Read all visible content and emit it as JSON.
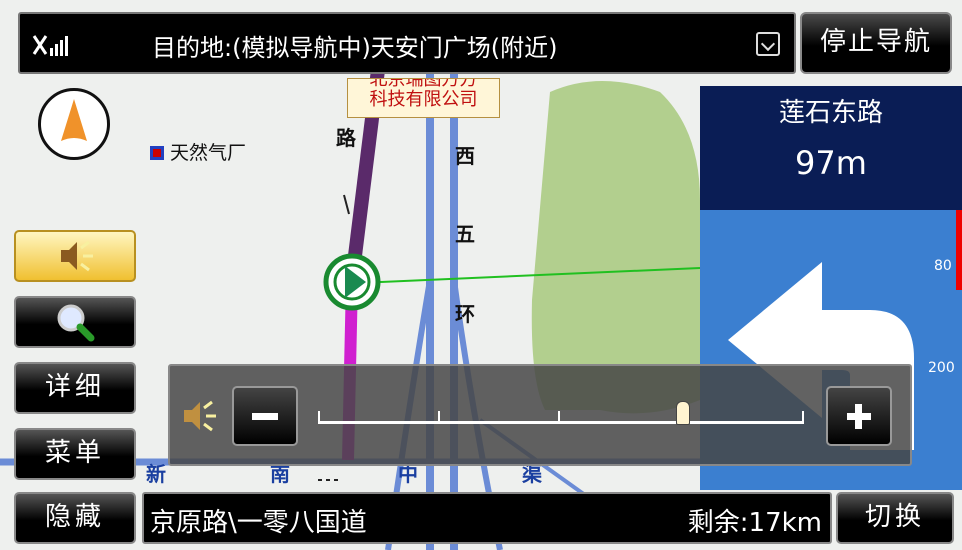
{
  "header": {
    "destination": "目的地:(模拟导航中)天安门广场(附近)",
    "stop_label": "停止导航"
  },
  "map": {
    "poi_label": "天然气厂",
    "company_lines": [
      "北京瑞图万方",
      "科技有限公司"
    ],
    "road_chars": [
      "路",
      "西",
      "五",
      "环"
    ],
    "bottom_chars": [
      "新",
      "南",
      "中",
      "渠"
    ]
  },
  "guide": {
    "next_road": "莲石东路",
    "distance": "97m",
    "scale_top": "80",
    "scale_bottom": "200"
  },
  "side_buttons": {
    "detail": "详细",
    "menu": "菜单",
    "hide": "隐藏"
  },
  "volume": {
    "level": 0.75
  },
  "footer": {
    "current_road": "京原路\\一零八国道",
    "remaining": "剩余:17km",
    "switch_label": "切换"
  },
  "colors": {
    "route_purple": "#5a2a6a",
    "route_magenta": "#d020d0",
    "road_blue": "#6b8cd6",
    "park_green": "#b2cf8e",
    "guide_panel": "#0a1d55",
    "arrow_panel": "#3b7fd0"
  }
}
